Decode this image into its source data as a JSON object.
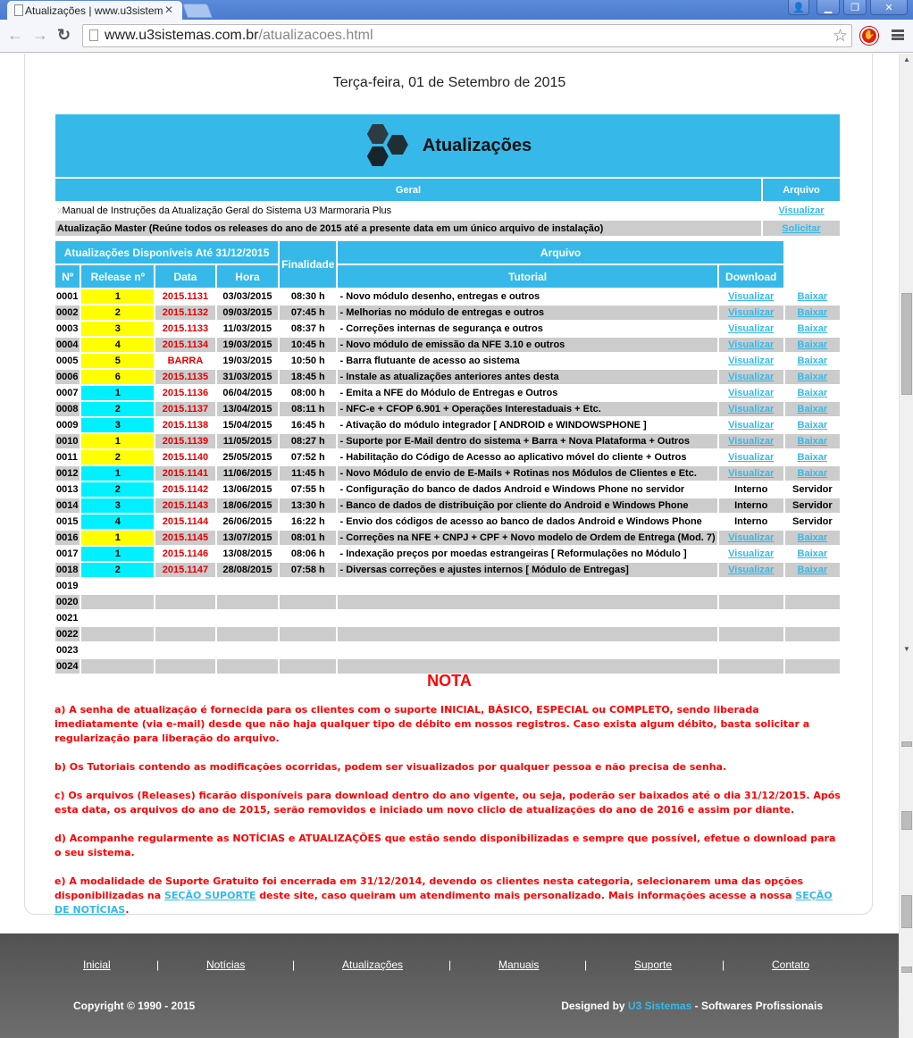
{
  "browser": {
    "tab_title": "Atualizações | www.u3sistem",
    "url_host": "www.u3sistemas.com.br",
    "url_path": "/atualizacoes.html"
  },
  "page": {
    "date": "Terça-feira, 01 de Setembro de 2015",
    "banner_title": "Atualizações",
    "geral_header": "Geral",
    "arquivo_header": "Arquivo",
    "geral_rows": [
      {
        "text": "Manual de Instruções da Atualização Geral do Sistema U3 Marmoraria Plus",
        "action": "Visualizar"
      },
      {
        "text": "Atualização Master (Reúne todos os releases do ano de 2015 até a presente data em um único arquivo de instalação)",
        "action": "Solicitar"
      }
    ],
    "table_header": {
      "available": "Atualizações Disponíveis Até 31/12/2015",
      "finalidade": "Finalidade",
      "arquivo": "Arquivo",
      "num": "Nº",
      "release": "Release nº",
      "data": "Data",
      "hora": "Hora",
      "tutorial": "Tutorial",
      "download": "Download"
    },
    "releases": [
      {
        "n": "0001",
        "badge": "1",
        "badge_color": "#ffff00",
        "release": "2015.1131",
        "data": "03/03/2015",
        "hora": "08:30 h",
        "finalidade": "- Novo módulo desenho, entregas e outros",
        "tutorial": "Visualizar",
        "download": "Baixar"
      },
      {
        "n": "0002",
        "badge": "2",
        "badge_color": "#ffff00",
        "release": "2015.1132",
        "data": "09/03/2015",
        "hora": "07:45 h",
        "finalidade": "- Melhorias no módulo de entregas e outros",
        "tutorial": "Visualizar",
        "download": "Baixar"
      },
      {
        "n": "0003",
        "badge": "3",
        "badge_color": "#ffff00",
        "release": "2015.1133",
        "data": "11/03/2015",
        "hora": "08:37 h",
        "finalidade": "- Correções internas de segurança e outros",
        "tutorial": "Visualizar",
        "download": "Baixar"
      },
      {
        "n": "0004",
        "badge": "4",
        "badge_color": "#ffff00",
        "release": "2015.1134",
        "data": "19/03/2015",
        "hora": "10:45 h",
        "finalidade": "- Novo módulo de emissão da NFE 3.10 e outros",
        "tutorial": "Visualizar",
        "download": "Baixar"
      },
      {
        "n": "0005",
        "badge": "5",
        "badge_color": "#ffff00",
        "release": "BARRA",
        "data": "19/03/2015",
        "hora": "10:50 h",
        "finalidade": "- Barra flutuante de acesso ao sistema",
        "tutorial": "Visualizar",
        "download": "Baixar"
      },
      {
        "n": "0006",
        "badge": "6",
        "badge_color": "#ffff00",
        "release": "2015.1135",
        "data": "31/03/2015",
        "hora": "18:45 h",
        "finalidade": "- Instale as atualizações anteriores antes desta",
        "tutorial": "Visualizar",
        "download": "Baixar"
      },
      {
        "n": "0007",
        "badge": "1",
        "badge_color": "#00f0ff",
        "release": "2015.1136",
        "data": "06/04/2015",
        "hora": "08:00 h",
        "finalidade": "- Emita a NFE do Módulo de Entregas e Outros",
        "tutorial": "Visualizar",
        "download": "Baixar"
      },
      {
        "n": "0008",
        "badge": "2",
        "badge_color": "#00f0ff",
        "release": "2015.1137",
        "data": "13/04/2015",
        "hora": "08:11 h",
        "finalidade": "- NFC-e + CFOP 6.901 + Operações Interestaduais + Etc.",
        "tutorial": "Visualizar",
        "download": "Baixar"
      },
      {
        "n": "0009",
        "badge": "3",
        "badge_color": "#00f0ff",
        "release": "2015.1138",
        "data": "15/04/2015",
        "hora": "16:45 h",
        "finalidade": "- Ativação do módulo integrador [ ANDROID e WINDOWSPHONE ]",
        "tutorial": "Visualizar",
        "download": "Baixar"
      },
      {
        "n": "0010",
        "badge": "1",
        "badge_color": "#ffff00",
        "release": "2015.1139",
        "data": "11/05/2015",
        "hora": "08:27 h",
        "finalidade": "- Suporte por E-Mail dentro do sistema + Barra + Nova Plataforma + Outros",
        "tutorial": "Visualizar",
        "download": "Baixar"
      },
      {
        "n": "0011",
        "badge": "2",
        "badge_color": "#ffff00",
        "release": "2015.1140",
        "data": "25/05/2015",
        "hora": "07:52 h",
        "finalidade": "- Habilitação do Código de Acesso ao aplicativo móvel do cliente + Outros",
        "tutorial": "Visualizar",
        "download": "Baixar"
      },
      {
        "n": "0012",
        "badge": "1",
        "badge_color": "#00f0ff",
        "release": "2015.1141",
        "data": "11/06/2015",
        "hora": "11:45 h",
        "finalidade": "- Novo Módulo de envio de E-Mails + Rotinas nos Módulos de Clientes e Etc.",
        "tutorial": "Visualizar",
        "download": "Baixar"
      },
      {
        "n": "0013",
        "badge": "2",
        "badge_color": "#00f0ff",
        "release": "2015.1142",
        "data": "13/06/2015",
        "hora": "07:55 h",
        "finalidade": "- Configuração do banco de dados Android e Windows Phone no servidor",
        "tutorial": "Interno",
        "download": "Servidor"
      },
      {
        "n": "0014",
        "badge": "3",
        "badge_color": "#00f0ff",
        "release": "2015.1143",
        "data": "18/06/2015",
        "hora": "13:30 h",
        "finalidade": "- Banco de dados de distribuição por cliente do Android e Windows Phone",
        "tutorial": "Interno",
        "download": "Servidor"
      },
      {
        "n": "0015",
        "badge": "4",
        "badge_color": "#00f0ff",
        "release": "2015.1144",
        "data": "26/06/2015",
        "hora": "16:22 h",
        "finalidade": "- Envio dos códigos de acesso ao banco de dados Android e Windows Phone",
        "tutorial": "Interno",
        "download": "Servidor"
      },
      {
        "n": "0016",
        "badge": "1",
        "badge_color": "#ffff00",
        "release": "2015.1145",
        "data": "13/07/2015",
        "hora": "08:01 h",
        "finalidade": "- Correções na NFE + CNPJ + CPF + Novo modelo de Ordem de Entrega (Mod. 7)",
        "tutorial": "Visualizar",
        "download": "Baixar"
      },
      {
        "n": "0017",
        "badge": "1",
        "badge_color": "#00f0ff",
        "release": "2015.1146",
        "data": "13/08/2015",
        "hora": "08:06 h",
        "finalidade": "- Indexação preços por moedas estrangeiras [ Reformulações no Módulo ]",
        "tutorial": "Visualizar",
        "download": "Baixar"
      },
      {
        "n": "0018",
        "badge": "2",
        "badge_color": "#00f0ff",
        "release": "2015.1147",
        "data": "28/08/2015",
        "hora": "07:58 h",
        "finalidade": "- Diversas correções e ajustes internos [ Módulo de Entregas]",
        "tutorial": "Visualizar",
        "download": "Baixar"
      },
      {
        "n": "0019"
      },
      {
        "n": "0020"
      },
      {
        "n": "0021"
      },
      {
        "n": "0022"
      },
      {
        "n": "0023"
      },
      {
        "n": "0024"
      }
    ],
    "nota_title": "NOTA",
    "notas": {
      "a": "a) A senha de atualização é fornecida para os clientes com o suporte INICIAL, BÁSICO, ESPECIAL ou COMPLETO, sendo liberada imediatamente (via e-mail) desde que não haja qualquer tipo de débito em nossos registros. Caso exista algum débito, basta solicitar a regularização para liberação do arquivo.",
      "b": "b) Os Tutoriais contendo as modificações ocorridas, podem ser visualizados por qualquer pessoa e não precisa de senha.",
      "c": "c) Os arquivos (Releases) ficarão disponíveis para download dentro do ano vigente, ou seja, poderão ser baixados até o dia 31/12/2015. Após esta data, os arquivos do ano de 2015, serão removidos e iniciado um novo cliclo de atualizações do ano de 2016 e assim por diante.",
      "d": "d) Acompanhe regularmente as NOTÍCIAS e ATUALIZAÇÕES que estão sendo disponibilizadas e sempre que possível, efetue o download para o seu sistema.",
      "e_pre": "e) A modalidade de Suporte Gratuito foi encerrada em 31/12/2014, devendo os clientes nesta categoria, selecionarem uma das opções disponibilizadas na ",
      "e_link1": "SEÇÃO SUPORTE",
      "e_mid": " deste site, caso queiram um atendimento mais personalizado. Mais informações acesse a nossa ",
      "e_link2": "SEÇÃO DE NOTÍCIAS",
      "e_post": "."
    }
  },
  "footer": {
    "nav": [
      "Inicial",
      "Notícias",
      "Atualizações",
      "Manuais",
      "Suporte",
      "Contato"
    ],
    "separator": "|",
    "copyright": "Copyright © 1990 - 2015",
    "designed_pre": "Designed by ",
    "designed_brand": "U3 Sistemas",
    "designed_post": " - Softwares Profissionais"
  },
  "colors": {
    "accent": "#36b9e9",
    "red": "#ff0000",
    "row_gray": "#cccccc"
  }
}
